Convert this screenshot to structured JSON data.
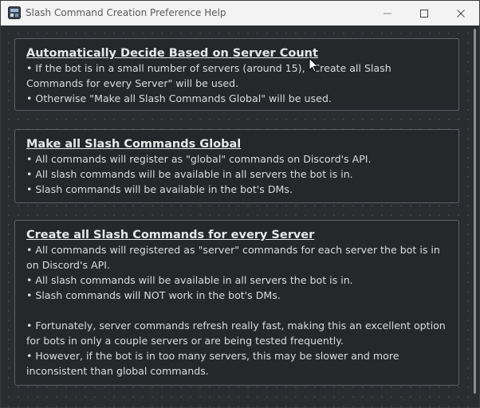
{
  "window": {
    "title": "Slash Command Creation Preference Help",
    "app_icon": "app-icon",
    "controls": {
      "minimize_icon": "minimize-icon",
      "maximize_icon": "maximize-icon",
      "close_icon": "close-icon"
    }
  },
  "sections": [
    {
      "heading": "Automatically Decide Based on Server Count",
      "lines": [
        "• If the bot is in a small number of servers (around 15), \"Create all Slash Commands for every Server\" will be used.",
        "• Otherwise \"Make all Slash Commands Global\" will be used."
      ]
    },
    {
      "heading": "Make all Slash Commands Global",
      "lines": [
        "• All commands will register as \"global\" commands on Discord's API.",
        "• All slash commands will be available in all servers the bot is in.",
        "• Slash commands will be available in the bot's DMs."
      ]
    },
    {
      "heading": "Create all Slash Commands for every Server",
      "lines": [
        "• All commands will registered as \"server\" commands for each server the bot is in on Discord's API.",
        "• All slash commands will be available in all servers the bot is in.",
        "• Slash commands will NOT work in the bot's DMs.",
        "• Fortunately, server commands refresh really fast, making this an excellent option for bots in only a couple servers or are being tested frequently.",
        "• However, if the bot is in too many servers, this may be slower and more inconsistent than global commands."
      ]
    }
  ]
}
